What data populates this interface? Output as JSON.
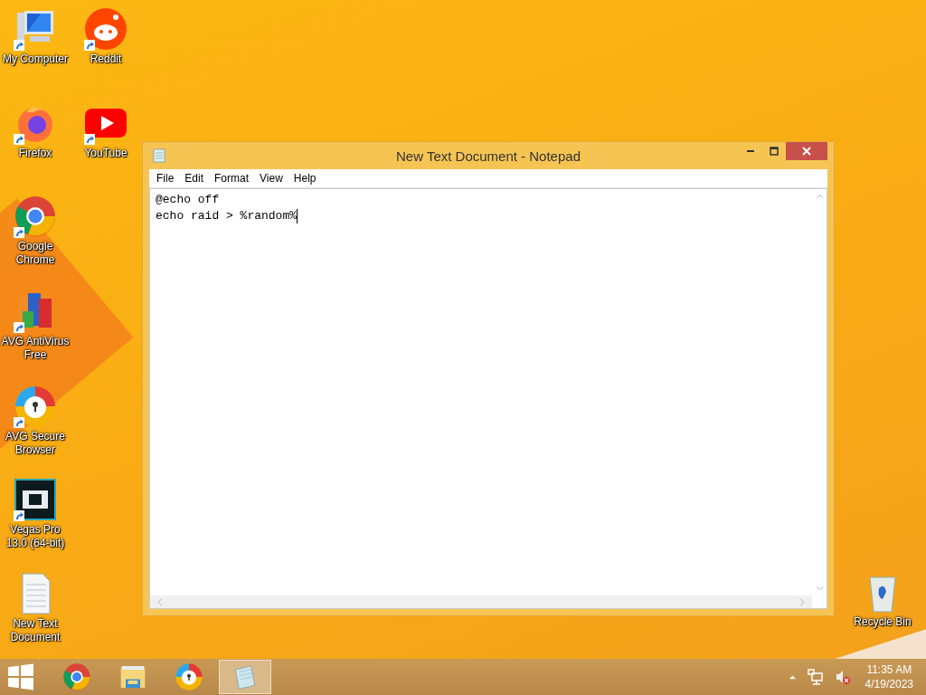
{
  "desktop_icons": [
    {
      "label": "My Computer",
      "kind": "computer",
      "shortcut": true
    },
    {
      "label": "Reddit",
      "kind": "reddit",
      "shortcut": true
    },
    {
      "label": "Firefox",
      "kind": "firefox",
      "shortcut": true
    },
    {
      "label": "YouTube",
      "kind": "youtube",
      "shortcut": true
    },
    {
      "label": "Google Chrome",
      "kind": "chrome",
      "shortcut": true
    },
    {
      "label": "AVG AntiVirus Free",
      "kind": "avg",
      "shortcut": true
    },
    {
      "label": "AVG Secure Browser",
      "kind": "avgbrowser",
      "shortcut": true
    },
    {
      "label": "Vegas Pro 13.0 (64-bit)",
      "kind": "vegas",
      "shortcut": true
    },
    {
      "label": "New Text Document",
      "kind": "textdoc",
      "shortcut": false
    },
    {
      "label": "Recycle Bin",
      "kind": "recycle",
      "shortcut": false
    }
  ],
  "notepad": {
    "title": "New Text Document - Notepad",
    "menu": [
      "File",
      "Edit",
      "Format",
      "View",
      "Help"
    ],
    "lines": [
      "@echo off",
      "echo raid > %random%"
    ]
  },
  "taskbar": {
    "items": [
      {
        "kind": "chrome",
        "selected": false
      },
      {
        "kind": "explorer",
        "selected": false
      },
      {
        "kind": "avgbrowser",
        "selected": false
      },
      {
        "kind": "notepad",
        "selected": true
      }
    ],
    "time": "11:35 AM",
    "date": "4/19/2023"
  }
}
